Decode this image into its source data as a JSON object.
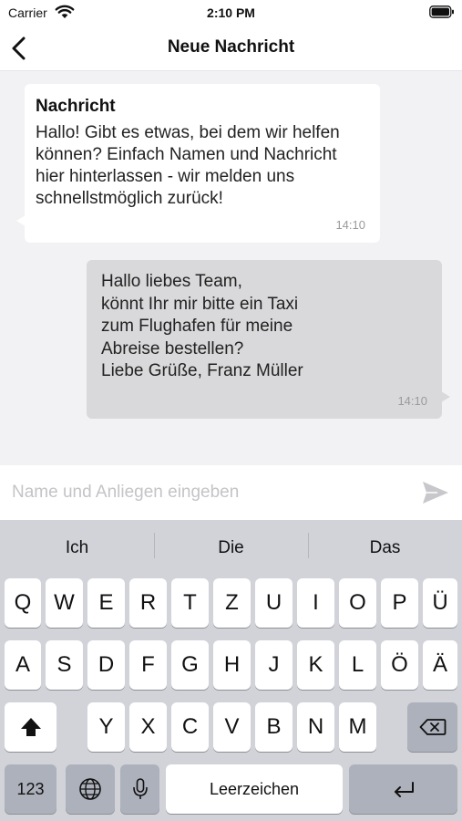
{
  "status_bar": {
    "carrier": "Carrier",
    "time": "2:10 PM",
    "icons": [
      "wifi-icon",
      "battery-icon"
    ]
  },
  "nav": {
    "title": "Neue Nachricht",
    "back_icon": "chevron-left-icon"
  },
  "chat": {
    "incoming": {
      "title": "Nachricht",
      "text": "Hallo! Gibt es etwas, bei dem wir helfen können? Einfach Namen und Nachricht hier hinterlassen - wir melden uns schnellstmöglich zurück!",
      "time": "14:10"
    },
    "outgoing": {
      "lines": [
        "Hallo liebes Team,",
        "könnt Ihr mir bitte ein Taxi",
        "zum Flughafen für meine",
        "Abreise bestellen?",
        "Liebe Grüße, Franz Müller"
      ],
      "time": "14:10"
    }
  },
  "composer": {
    "placeholder": "Name und Anliegen eingeben",
    "value": "",
    "send_icon": "send-icon"
  },
  "keyboard": {
    "suggestions": [
      "Ich",
      "Die",
      "Das"
    ],
    "row1": [
      "Q",
      "W",
      "E",
      "R",
      "T",
      "Z",
      "U",
      "I",
      "O",
      "P",
      "Ü"
    ],
    "row2": [
      "A",
      "S",
      "D",
      "F",
      "G",
      "H",
      "J",
      "K",
      "L",
      "Ö",
      "Ä"
    ],
    "row3": [
      "Y",
      "X",
      "C",
      "V",
      "B",
      "N",
      "M"
    ],
    "numbers_label": "123",
    "space_label": "Leerzeichen",
    "icons": [
      "shift-icon",
      "backspace-icon",
      "globe-icon",
      "microphone-icon",
      "return-icon"
    ]
  },
  "colors": {
    "background": "#f2f2f4",
    "incoming_bubble": "#ffffff",
    "outgoing_bubble": "#d9d9db",
    "keyboard": "#d1d3d9",
    "key": "#ffffff",
    "key_dark": "#adb1bb"
  }
}
